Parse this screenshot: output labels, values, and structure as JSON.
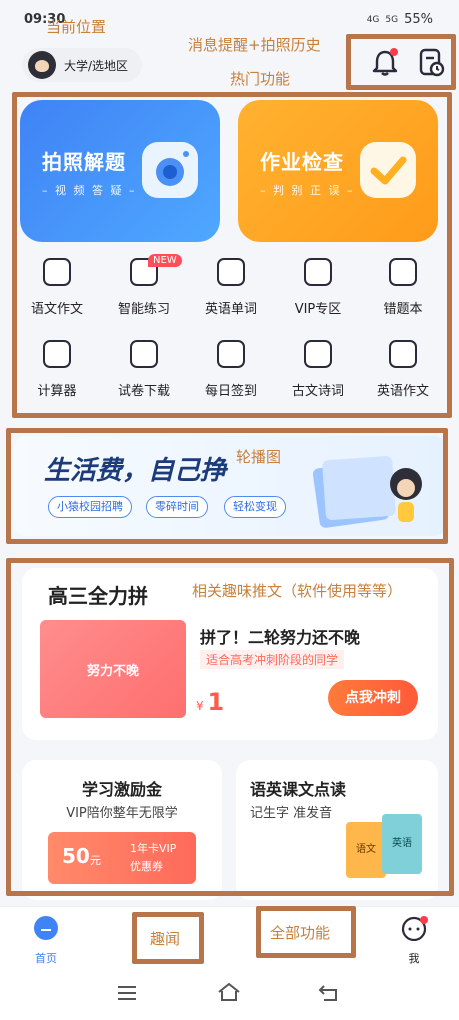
{
  "status_bar": {
    "time": "09:30",
    "network": "4G",
    "network2": "5G",
    "battery": "55%"
  },
  "annotations": {
    "location": "当前位置",
    "notify": "消息提醒+拍照历史",
    "hot": "热门功能",
    "carousel": "轮播图",
    "promo": "相关趣味推文（软件使用等等）",
    "news": "趣闻",
    "all": "全部功能"
  },
  "header": {
    "location_label": "大学/选地区"
  },
  "hero": {
    "left": {
      "title": "拍照解题",
      "subtitle": "– 视 频 答 疑 –"
    },
    "right": {
      "title": "作业检查",
      "subtitle": "– 判 别 正 误 –"
    }
  },
  "grid_badge": "NEW",
  "grid": [
    {
      "label": "语文作文",
      "icon": "text-icon"
    },
    {
      "label": "智能练习",
      "icon": "practice-icon"
    },
    {
      "label": "英语单词",
      "icon": "letter-a-icon"
    },
    {
      "label": "VIP专区",
      "icon": "vip-icon"
    },
    {
      "label": "错题本",
      "icon": "wrong-book-icon"
    },
    {
      "label": "计算器",
      "icon": "calculator-icon"
    },
    {
      "label": "试卷下载",
      "icon": "download-icon"
    },
    {
      "label": "每日签到",
      "icon": "checkin-icon"
    },
    {
      "label": "古文诗词",
      "icon": "bookmark-icon"
    },
    {
      "label": "英语作文",
      "icon": "letter-a-icon"
    }
  ],
  "banner": {
    "headline": "生活费，自己挣",
    "tags": [
      "小猿校园招聘",
      "零碎时间",
      "轻松变现"
    ]
  },
  "feature": {
    "title": "高三全力拼",
    "thumb_text": "努力不晚",
    "headline": "拼了！二轮努力还不晚",
    "subtitle": "适合高考冲刺阶段的同学",
    "price_symbol": "¥",
    "price": "1",
    "cta": "点我冲刺"
  },
  "cards": {
    "left": {
      "title": "学习激励金",
      "subtitle": "VIP陪你整年无限学",
      "coupon_value": "50",
      "coupon_unit": "元",
      "coupon_text1": "1年卡VIP",
      "coupon_text2": "优惠券"
    },
    "right": {
      "title": "语英课文点读",
      "subtitle": "记生字 准发音",
      "book1": "语文",
      "book2": "英语"
    }
  },
  "bottom_nav": {
    "home": "首页",
    "me": "我"
  }
}
